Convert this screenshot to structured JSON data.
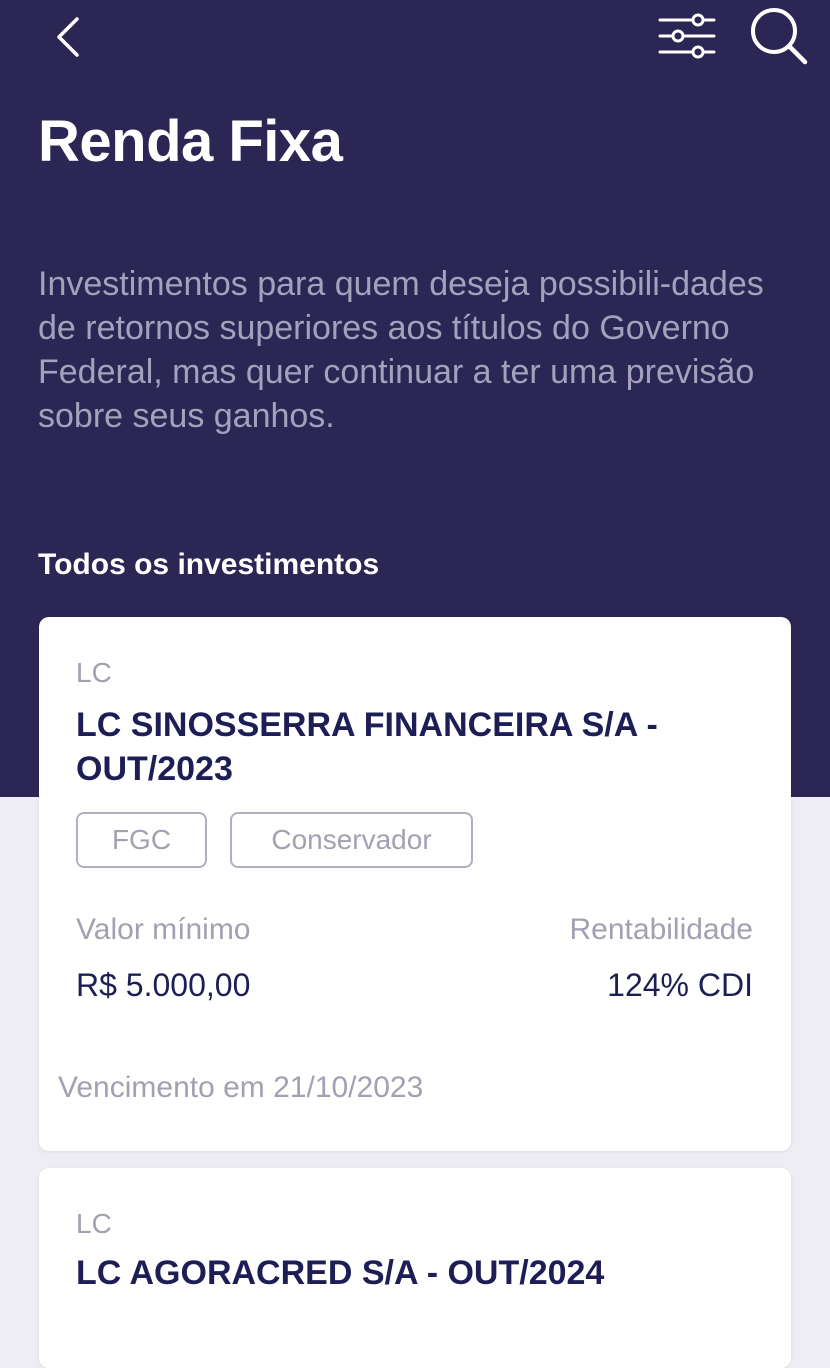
{
  "header": {
    "back_icon": "chevron-left-icon",
    "filter_icon": "sliders-icon",
    "search_icon": "search-icon",
    "title": "Renda Fixa",
    "description": "Investimentos para quem deseja possibili-dades de retornos superiores aos títulos do Governo Federal, mas quer continuar a ter uma previsão sobre seus ganhos."
  },
  "section": {
    "title": "Todos os investimentos"
  },
  "investments": [
    {
      "category": "LC",
      "name": "LC SINOSSERRA FINANCEIRA S/A - OUT/2023",
      "tags": [
        "FGC",
        "Conservador"
      ],
      "min_value_label": "Valor mínimo",
      "min_value": "R$ 5.000,00",
      "return_label": "Rentabilidade",
      "return_value": "124% CDI",
      "maturity": "Vencimento em 21/10/2023"
    },
    {
      "category": "LC",
      "name": "LC AGORACRED S/A - OUT/2024"
    }
  ],
  "colors": {
    "header_bg": "#2b2654",
    "page_bg": "#eeedf3",
    "card_bg": "#ffffff",
    "title_dark": "#1e1e56",
    "muted": "#a2a1b3"
  }
}
